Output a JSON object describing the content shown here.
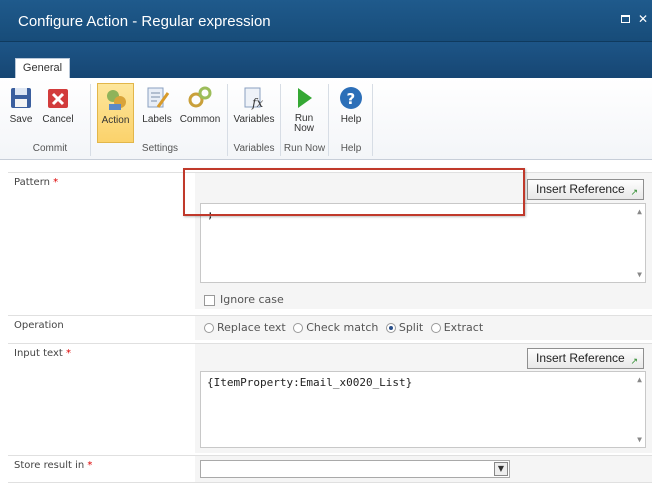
{
  "window": {
    "title": "Configure Action - Regular expression"
  },
  "tabs": [
    {
      "label": "General"
    }
  ],
  "ribbon": {
    "buttons": [
      {
        "label": "Save"
      },
      {
        "label": "Cancel"
      },
      {
        "label": "Action"
      },
      {
        "label": "Labels"
      },
      {
        "label": "Common"
      },
      {
        "label": "Variables"
      },
      {
        "label": "Run Now"
      },
      {
        "label": "Help"
      }
    ],
    "groups": [
      {
        "label": "Commit"
      },
      {
        "label": "Settings"
      },
      {
        "label": "Variables"
      },
      {
        "label": "Run Now"
      },
      {
        "label": "Help"
      }
    ]
  },
  "form": {
    "pattern": {
      "label": "Pattern",
      "required_mark": "*",
      "value": ";",
      "insert_reference": "Insert Reference"
    },
    "ignore_case": {
      "label": "Ignore case",
      "checked": false
    },
    "operation": {
      "label": "Operation",
      "options": [
        "Replace text",
        "Check match",
        "Split",
        "Extract"
      ],
      "selected": "Split"
    },
    "input_text": {
      "label": "Input text",
      "required_mark": "*",
      "value": "{ItemProperty:Email_x0020_List}",
      "insert_reference": "Insert Reference"
    },
    "store_result": {
      "label": "Store result in",
      "required_mark": "*",
      "value": ""
    }
  },
  "colors": {
    "titlebar": "#1f5a8c",
    "selected_button": "#fbd26b",
    "highlight_box": "#c0392b",
    "required": "#dd0000"
  }
}
